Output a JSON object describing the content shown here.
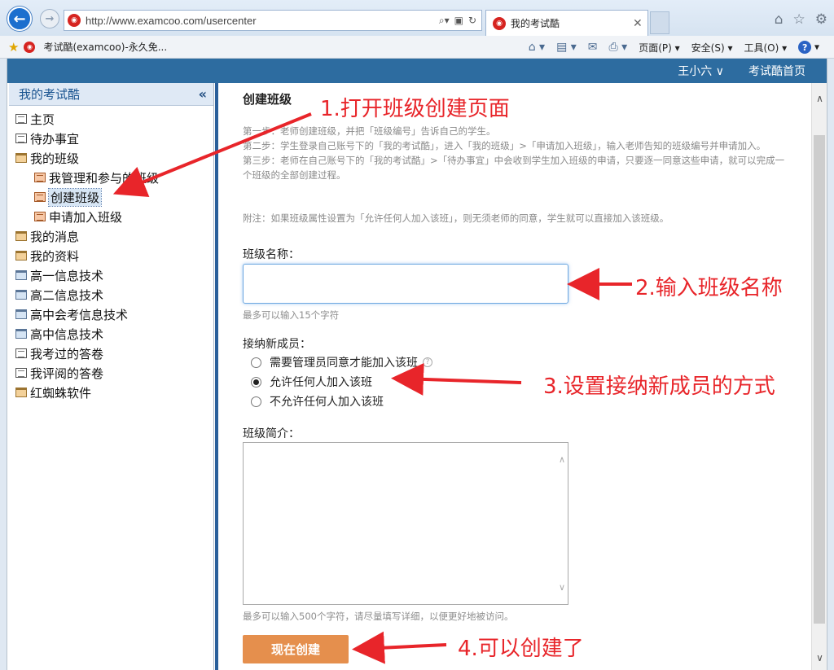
{
  "browser": {
    "url": "http://www.examcoo.com/usercenter",
    "site_icon": "examcoo-logo",
    "tab_title": "我的考试酷",
    "favorite_label": "考试酷(examcoo)-永久免...",
    "menu": {
      "page": "页面(P)",
      "safety": "安全(S)",
      "tools": "工具(O)"
    }
  },
  "topnav": {
    "user": "王小六 ∨",
    "home_link": "考试酷首页"
  },
  "sidebar": {
    "title": "我的考试酷",
    "collapse": "«",
    "items": [
      {
        "label": "主页"
      },
      {
        "label": "待办事宜"
      },
      {
        "label": "我的班级"
      },
      {
        "label": "我管理和参与的班级"
      },
      {
        "label": "创建班级"
      },
      {
        "label": "申请加入班级"
      },
      {
        "label": "我的消息"
      },
      {
        "label": "我的资料"
      },
      {
        "label": "高一信息技术"
      },
      {
        "label": "高二信息技术"
      },
      {
        "label": "高中会考信息技术"
      },
      {
        "label": "高中信息技术"
      },
      {
        "label": "我考过的答卷"
      },
      {
        "label": "我评阅的答卷"
      },
      {
        "label": "红蜘蛛软件"
      }
    ]
  },
  "content": {
    "title": "创建班级",
    "step1": "第一步：老师创建班级，并把「班级编号」告诉自己的学生。",
    "step2": "第二步：学生登录自己账号下的「我的考试酷」，进入「我的班级」>「申请加入班级」，输入老师告知的班级编号并申请加入。",
    "step3": "第三步：老师在自己账号下的「我的考试酷」>「待办事宜」中会收到学生加入班级的申请，只要逐一同意这些申请，就可以完成一个班级的全部创建过程。",
    "note": "附注：如果班级属性设置为「允许任何人加入该班」，则无须老师的同意，学生就可以直接加入该班级。",
    "name_label": "班级名称：",
    "name_value": "",
    "name_hint": "最多可以输入15个字符",
    "member_label": "接纳新成员：",
    "options": [
      {
        "label": "需要管理员同意才能加入该班",
        "checked": false
      },
      {
        "label": "允许任何人加入该班",
        "checked": true
      },
      {
        "label": "不允许任何人加入该班",
        "checked": false
      }
    ],
    "intro_label": "班级简介：",
    "intro_value": "",
    "intro_hint": "最多可以输入500个字符，请尽量填写详细，以便更好地被访问。",
    "create_button": "现在创建"
  },
  "annotations": {
    "step1": "1.打开班级创建页面",
    "step2": "2.输入班级名称",
    "step3": "3.设置接纳新成员的方式",
    "step4": "4.可以创建了",
    "color": "#e8252a"
  },
  "colors": {
    "topnav": "#2d6ca0",
    "button": "#e58f4d",
    "accent_blue": "#1c6fce"
  }
}
